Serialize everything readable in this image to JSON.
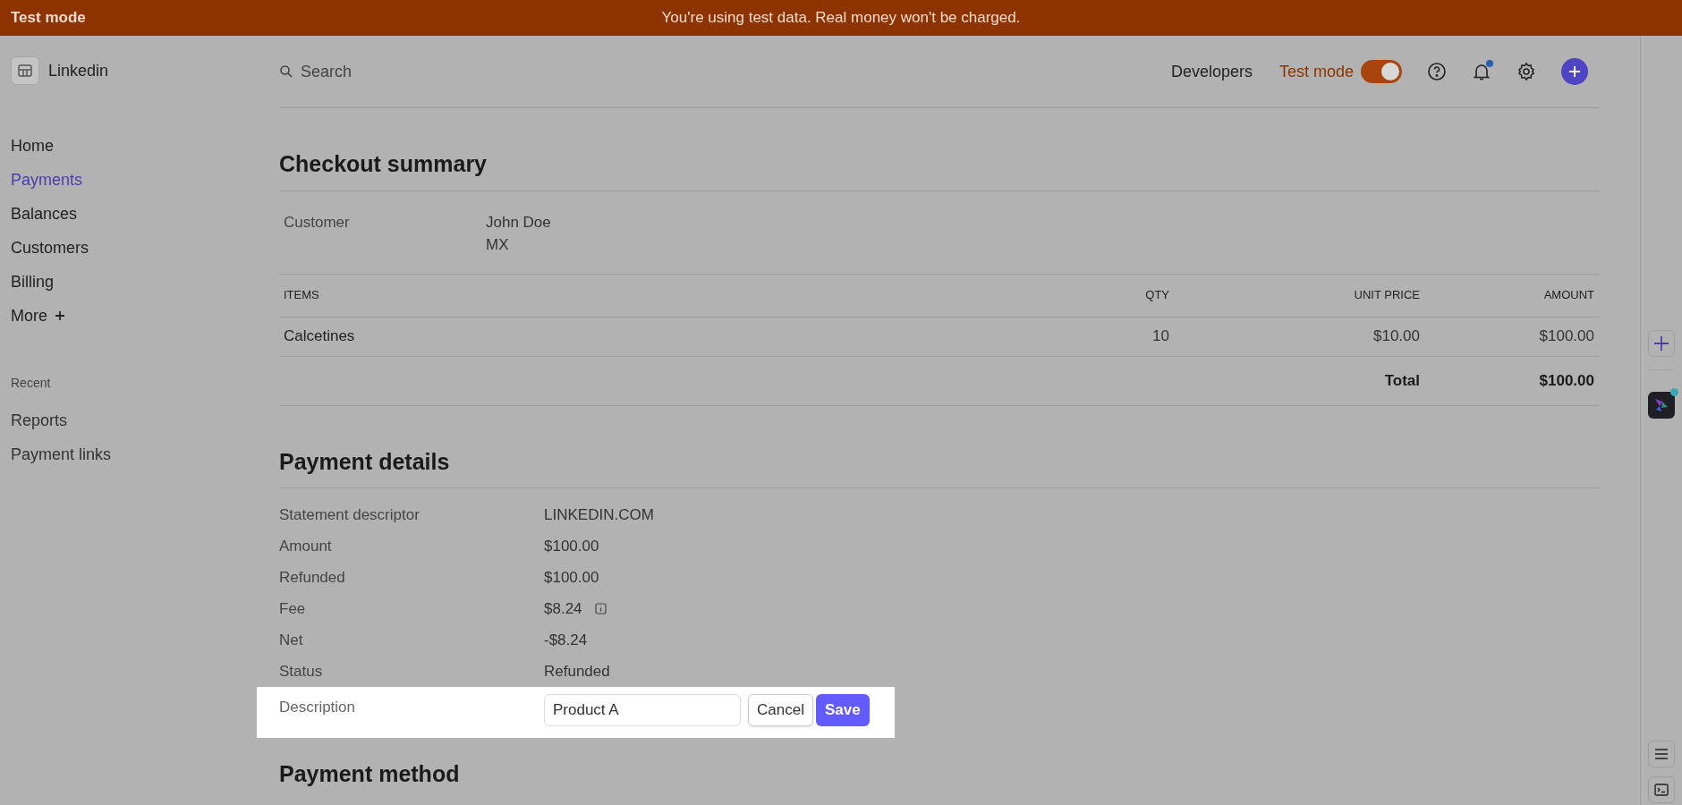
{
  "banner": {
    "mode_label": "Test mode",
    "message": "You're using test data. Real money won't be charged."
  },
  "account": {
    "name": "Linkedin"
  },
  "search": {
    "placeholder": "Search"
  },
  "header": {
    "developers": "Developers",
    "test_mode": {
      "label": "Test mode",
      "on": true
    },
    "notifications_unread": true
  },
  "nav": {
    "items": [
      {
        "label": "Home",
        "selected": false
      },
      {
        "label": "Payments",
        "selected": true
      },
      {
        "label": "Balances",
        "selected": false
      },
      {
        "label": "Customers",
        "selected": false
      },
      {
        "label": "Billing",
        "selected": false
      }
    ],
    "more": "More",
    "recent_heading": "Recent",
    "recent_items": [
      "Reports",
      "Payment links"
    ]
  },
  "checkout": {
    "title": "Checkout summary",
    "customer_label": "Customer",
    "customer_lines": [
      "John Doe",
      "MX"
    ],
    "columns": [
      "ITEMS",
      "QTY",
      "UNIT PRICE",
      "AMOUNT"
    ],
    "rows": [
      {
        "item": "Calcetines",
        "qty": "10",
        "unit_price": "$10.00",
        "amount": "$100.00"
      }
    ],
    "total_label": "Total",
    "total_value": "$100.00"
  },
  "payment_details": {
    "title": "Payment details",
    "rows": [
      {
        "label": "Statement descriptor",
        "value": "LINKEDIN.COM",
        "info": false
      },
      {
        "label": "Amount",
        "value": "$100.00",
        "info": false
      },
      {
        "label": "Refunded",
        "value": "$100.00",
        "info": false
      },
      {
        "label": "Fee",
        "value": "$8.24",
        "info": true
      },
      {
        "label": "Net",
        "value": "-$8.24",
        "info": false
      },
      {
        "label": "Status",
        "value": "Refunded",
        "info": false
      }
    ],
    "description": {
      "label": "Description",
      "value": "Product A",
      "cancel": "Cancel",
      "save": "Save"
    }
  },
  "next_section": {
    "title": "Payment method"
  },
  "assistant": {
    "unread": true
  }
}
